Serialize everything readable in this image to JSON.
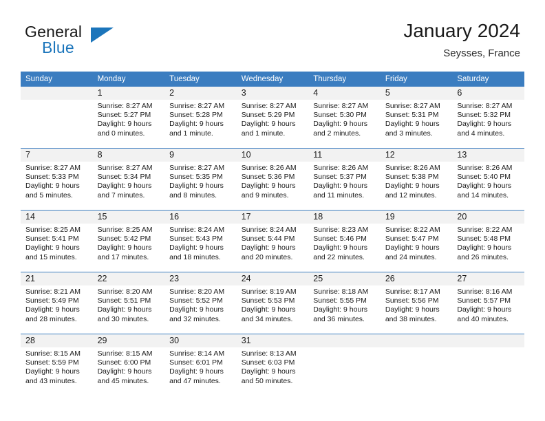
{
  "brand": {
    "word_one": "General",
    "word_two": "Blue",
    "logo_icon": "triangle-logo-icon",
    "accent_color": "#1b75bb"
  },
  "header": {
    "title": "January 2024",
    "subtitle": "Seysses, France"
  },
  "theme": {
    "header_blue": "#3b7dc0",
    "daynum_band": "#f2f2f2",
    "cell_background": "#ffffff"
  },
  "calendar": {
    "weekdays": [
      "Sunday",
      "Monday",
      "Tuesday",
      "Wednesday",
      "Thursday",
      "Friday",
      "Saturday"
    ],
    "weeks": [
      [
        {
          "day": "",
          "sunrise": "",
          "sunset": "",
          "daylight_1": "",
          "daylight_2": ""
        },
        {
          "day": "1",
          "sunrise": "Sunrise: 8:27 AM",
          "sunset": "Sunset: 5:27 PM",
          "daylight_1": "Daylight: 9 hours",
          "daylight_2": "and 0 minutes."
        },
        {
          "day": "2",
          "sunrise": "Sunrise: 8:27 AM",
          "sunset": "Sunset: 5:28 PM",
          "daylight_1": "Daylight: 9 hours",
          "daylight_2": "and 1 minute."
        },
        {
          "day": "3",
          "sunrise": "Sunrise: 8:27 AM",
          "sunset": "Sunset: 5:29 PM",
          "daylight_1": "Daylight: 9 hours",
          "daylight_2": "and 1 minute."
        },
        {
          "day": "4",
          "sunrise": "Sunrise: 8:27 AM",
          "sunset": "Sunset: 5:30 PM",
          "daylight_1": "Daylight: 9 hours",
          "daylight_2": "and 2 minutes."
        },
        {
          "day": "5",
          "sunrise": "Sunrise: 8:27 AM",
          "sunset": "Sunset: 5:31 PM",
          "daylight_1": "Daylight: 9 hours",
          "daylight_2": "and 3 minutes."
        },
        {
          "day": "6",
          "sunrise": "Sunrise: 8:27 AM",
          "sunset": "Sunset: 5:32 PM",
          "daylight_1": "Daylight: 9 hours",
          "daylight_2": "and 4 minutes."
        }
      ],
      [
        {
          "day": "7",
          "sunrise": "Sunrise: 8:27 AM",
          "sunset": "Sunset: 5:33 PM",
          "daylight_1": "Daylight: 9 hours",
          "daylight_2": "and 5 minutes."
        },
        {
          "day": "8",
          "sunrise": "Sunrise: 8:27 AM",
          "sunset": "Sunset: 5:34 PM",
          "daylight_1": "Daylight: 9 hours",
          "daylight_2": "and 7 minutes."
        },
        {
          "day": "9",
          "sunrise": "Sunrise: 8:27 AM",
          "sunset": "Sunset: 5:35 PM",
          "daylight_1": "Daylight: 9 hours",
          "daylight_2": "and 8 minutes."
        },
        {
          "day": "10",
          "sunrise": "Sunrise: 8:26 AM",
          "sunset": "Sunset: 5:36 PM",
          "daylight_1": "Daylight: 9 hours",
          "daylight_2": "and 9 minutes."
        },
        {
          "day": "11",
          "sunrise": "Sunrise: 8:26 AM",
          "sunset": "Sunset: 5:37 PM",
          "daylight_1": "Daylight: 9 hours",
          "daylight_2": "and 11 minutes."
        },
        {
          "day": "12",
          "sunrise": "Sunrise: 8:26 AM",
          "sunset": "Sunset: 5:38 PM",
          "daylight_1": "Daylight: 9 hours",
          "daylight_2": "and 12 minutes."
        },
        {
          "day": "13",
          "sunrise": "Sunrise: 8:26 AM",
          "sunset": "Sunset: 5:40 PM",
          "daylight_1": "Daylight: 9 hours",
          "daylight_2": "and 14 minutes."
        }
      ],
      [
        {
          "day": "14",
          "sunrise": "Sunrise: 8:25 AM",
          "sunset": "Sunset: 5:41 PM",
          "daylight_1": "Daylight: 9 hours",
          "daylight_2": "and 15 minutes."
        },
        {
          "day": "15",
          "sunrise": "Sunrise: 8:25 AM",
          "sunset": "Sunset: 5:42 PM",
          "daylight_1": "Daylight: 9 hours",
          "daylight_2": "and 17 minutes."
        },
        {
          "day": "16",
          "sunrise": "Sunrise: 8:24 AM",
          "sunset": "Sunset: 5:43 PM",
          "daylight_1": "Daylight: 9 hours",
          "daylight_2": "and 18 minutes."
        },
        {
          "day": "17",
          "sunrise": "Sunrise: 8:24 AM",
          "sunset": "Sunset: 5:44 PM",
          "daylight_1": "Daylight: 9 hours",
          "daylight_2": "and 20 minutes."
        },
        {
          "day": "18",
          "sunrise": "Sunrise: 8:23 AM",
          "sunset": "Sunset: 5:46 PM",
          "daylight_1": "Daylight: 9 hours",
          "daylight_2": "and 22 minutes."
        },
        {
          "day": "19",
          "sunrise": "Sunrise: 8:22 AM",
          "sunset": "Sunset: 5:47 PM",
          "daylight_1": "Daylight: 9 hours",
          "daylight_2": "and 24 minutes."
        },
        {
          "day": "20",
          "sunrise": "Sunrise: 8:22 AM",
          "sunset": "Sunset: 5:48 PM",
          "daylight_1": "Daylight: 9 hours",
          "daylight_2": "and 26 minutes."
        }
      ],
      [
        {
          "day": "21",
          "sunrise": "Sunrise: 8:21 AM",
          "sunset": "Sunset: 5:49 PM",
          "daylight_1": "Daylight: 9 hours",
          "daylight_2": "and 28 minutes."
        },
        {
          "day": "22",
          "sunrise": "Sunrise: 8:20 AM",
          "sunset": "Sunset: 5:51 PM",
          "daylight_1": "Daylight: 9 hours",
          "daylight_2": "and 30 minutes."
        },
        {
          "day": "23",
          "sunrise": "Sunrise: 8:20 AM",
          "sunset": "Sunset: 5:52 PM",
          "daylight_1": "Daylight: 9 hours",
          "daylight_2": "and 32 minutes."
        },
        {
          "day": "24",
          "sunrise": "Sunrise: 8:19 AM",
          "sunset": "Sunset: 5:53 PM",
          "daylight_1": "Daylight: 9 hours",
          "daylight_2": "and 34 minutes."
        },
        {
          "day": "25",
          "sunrise": "Sunrise: 8:18 AM",
          "sunset": "Sunset: 5:55 PM",
          "daylight_1": "Daylight: 9 hours",
          "daylight_2": "and 36 minutes."
        },
        {
          "day": "26",
          "sunrise": "Sunrise: 8:17 AM",
          "sunset": "Sunset: 5:56 PM",
          "daylight_1": "Daylight: 9 hours",
          "daylight_2": "and 38 minutes."
        },
        {
          "day": "27",
          "sunrise": "Sunrise: 8:16 AM",
          "sunset": "Sunset: 5:57 PM",
          "daylight_1": "Daylight: 9 hours",
          "daylight_2": "and 40 minutes."
        }
      ],
      [
        {
          "day": "28",
          "sunrise": "Sunrise: 8:15 AM",
          "sunset": "Sunset: 5:59 PM",
          "daylight_1": "Daylight: 9 hours",
          "daylight_2": "and 43 minutes."
        },
        {
          "day": "29",
          "sunrise": "Sunrise: 8:15 AM",
          "sunset": "Sunset: 6:00 PM",
          "daylight_1": "Daylight: 9 hours",
          "daylight_2": "and 45 minutes."
        },
        {
          "day": "30",
          "sunrise": "Sunrise: 8:14 AM",
          "sunset": "Sunset: 6:01 PM",
          "daylight_1": "Daylight: 9 hours",
          "daylight_2": "and 47 minutes."
        },
        {
          "day": "31",
          "sunrise": "Sunrise: 8:13 AM",
          "sunset": "Sunset: 6:03 PM",
          "daylight_1": "Daylight: 9 hours",
          "daylight_2": "and 50 minutes."
        },
        {
          "day": "",
          "sunrise": "",
          "sunset": "",
          "daylight_1": "",
          "daylight_2": ""
        },
        {
          "day": "",
          "sunrise": "",
          "sunset": "",
          "daylight_1": "",
          "daylight_2": ""
        },
        {
          "day": "",
          "sunrise": "",
          "sunset": "",
          "daylight_1": "",
          "daylight_2": ""
        }
      ]
    ]
  }
}
